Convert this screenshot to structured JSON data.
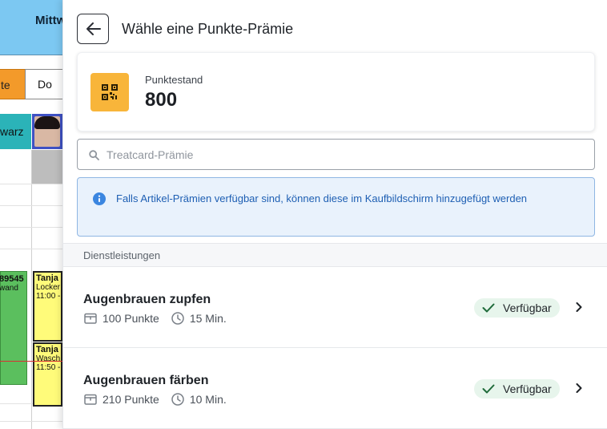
{
  "background": {
    "header_text": "Mittw",
    "day_tab_orange": "te",
    "day_tab_do": "Do",
    "staff_name_partial": "warz",
    "green_booking": {
      "line1": "89545",
      "line2": "wand"
    },
    "yellow_bookings": [
      {
        "name": "Tanja F",
        "service": "Locker",
        "time": "11:00 -"
      },
      {
        "name": "Tanja F",
        "service": "Wasch",
        "time": "11:50 -"
      }
    ]
  },
  "modal": {
    "title": "Wähle eine Punkte-Prämie",
    "back_icon": "arrow-left-icon"
  },
  "points": {
    "label": "Punktestand",
    "value": "800",
    "icon": "qr-code-icon",
    "icon_color": "#f8b53a"
  },
  "search": {
    "placeholder": "Treatcard-Prämie",
    "value": ""
  },
  "info": {
    "text": "Falls Artikel-Prämien verfügbar sind, können diese im Kaufbildschirm hinzugefügt werden",
    "color": "#1e5fb3"
  },
  "section": {
    "title": "Dienstleistungen"
  },
  "services": [
    {
      "name": "Augenbrauen zupfen",
      "points": "100 Punkte",
      "duration": "15 Min.",
      "status": "Verfügbar"
    },
    {
      "name": "Augenbrauen färben",
      "points": "210 Punkte",
      "duration": "10 Min.",
      "status": "Verfügbar"
    }
  ]
}
